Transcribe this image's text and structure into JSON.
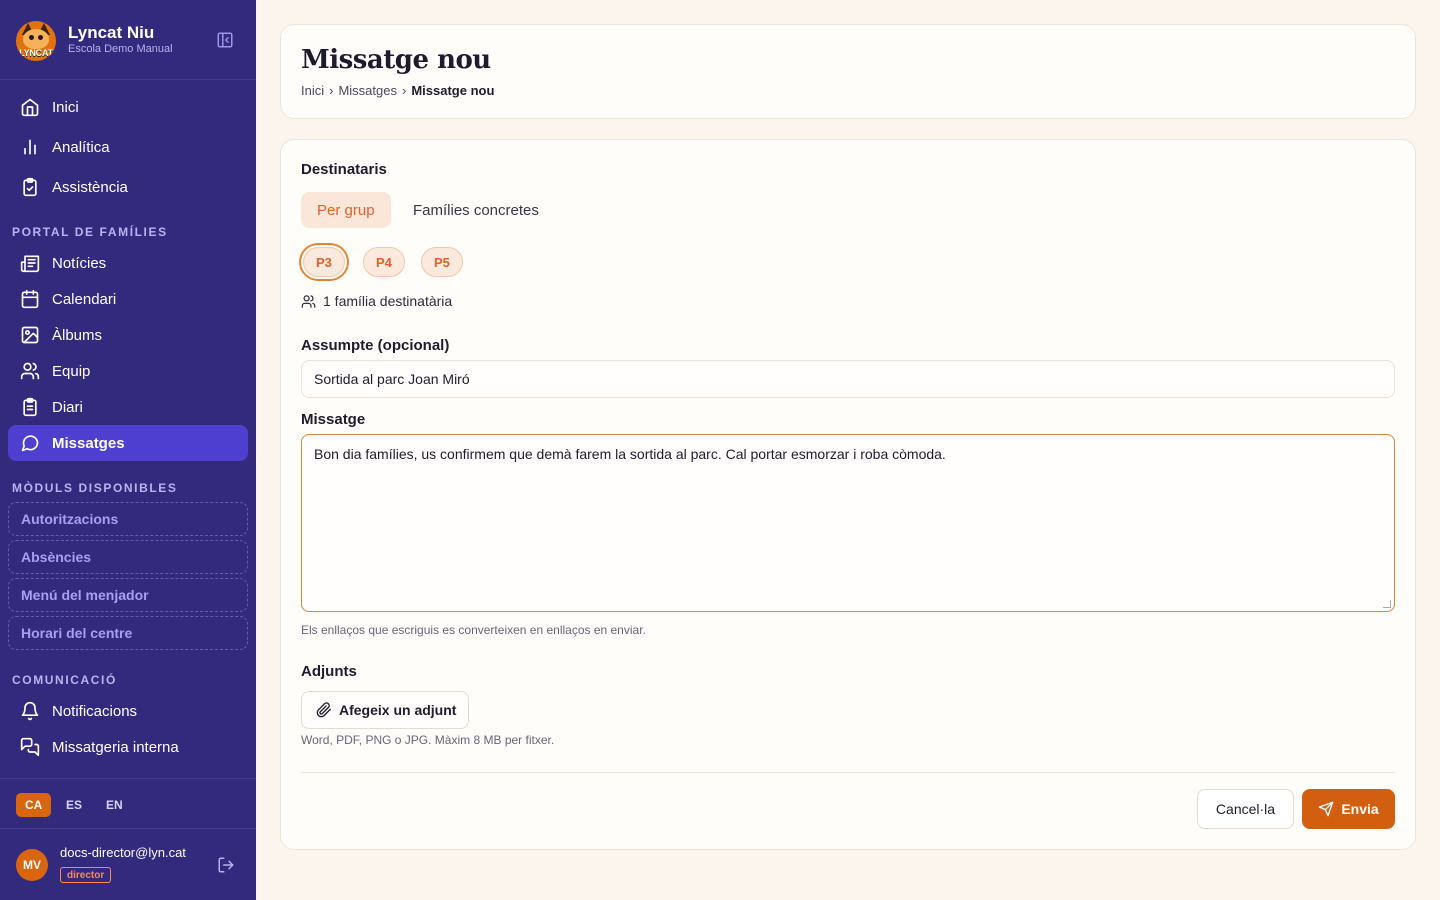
{
  "brand": {
    "name": "Lyncat Niu",
    "school": "Escola Demo Manual",
    "logo_text": "LYNCAT",
    "logo_icon": "lynx-mascot-logo"
  },
  "nav": {
    "main_items": [
      {
        "label": "Inici",
        "icon": "home-icon"
      },
      {
        "label": "Analítica",
        "icon": "bar-chart-icon"
      },
      {
        "label": "Assistència",
        "icon": "clipboard-check-icon"
      }
    ],
    "portal_title": "PORTAL DE FAMÍLIES",
    "portal_items": [
      {
        "label": "Notícies",
        "icon": "newspaper-icon"
      },
      {
        "label": "Calendari",
        "icon": "calendar-icon"
      },
      {
        "label": "Àlbums",
        "icon": "image-icon"
      },
      {
        "label": "Equip",
        "icon": "users-icon"
      },
      {
        "label": "Diari",
        "icon": "clipboard-list-icon"
      },
      {
        "label": "Missatges",
        "icon": "message-circle-icon",
        "active": true
      }
    ],
    "modules_title": "MÒDULS DISPONIBLES",
    "modules": [
      "Autoritzacions",
      "Absències",
      "Menú del menjador",
      "Horari del centre"
    ],
    "comm_title": "COMUNICACIÓ",
    "comm_items": [
      {
        "label": "Notificacions",
        "icon": "bell-icon"
      },
      {
        "label": "Missatgeria interna",
        "icon": "messages-square-icon"
      }
    ]
  },
  "languages": [
    {
      "code": "CA",
      "active": true
    },
    {
      "code": "ES",
      "active": false
    },
    {
      "code": "EN",
      "active": false
    }
  ],
  "user": {
    "initials": "MV",
    "email": "docs-director@lyn.cat",
    "role": "director"
  },
  "page": {
    "title": "Missatge nou",
    "breadcrumb": [
      "Inici",
      "Missatges",
      "Missatge nou"
    ],
    "breadcrumb_separator": "›"
  },
  "form": {
    "recipients_label": "Destinataris",
    "tabs": [
      {
        "label": "Per grup",
        "active": true
      },
      {
        "label": "Famílies concretes",
        "active": false
      }
    ],
    "groups": [
      {
        "label": "P3",
        "selected": true
      },
      {
        "label": "P4",
        "selected": false
      },
      {
        "label": "P5",
        "selected": false
      }
    ],
    "recipient_count": "1 família destinatària",
    "subject_label": "Assumpte (opcional)",
    "subject_value": "Sortida al parc Joan Miró",
    "message_label": "Missatge",
    "message_value": "Bon dia famílies, us confirmem que demà farem la sortida al parc. Cal portar esmorzar i roba còmoda.",
    "message_help": "Els enllaços que escriguis es converteixen en enllaços en enviar.",
    "attachments_label": "Adjunts",
    "attach_button": "Afegeix un adjunt",
    "attach_help": "Word, PDF, PNG o JPG. Màxim 8 MB per fitxer.",
    "cancel_button": "Cancel·la",
    "send_button": "Envia"
  },
  "colors": {
    "sidebar_bg": "#33297d",
    "active_nav": "#4f3fd1",
    "accent": "#d25f10",
    "page_bg": "#fbf5ee"
  }
}
